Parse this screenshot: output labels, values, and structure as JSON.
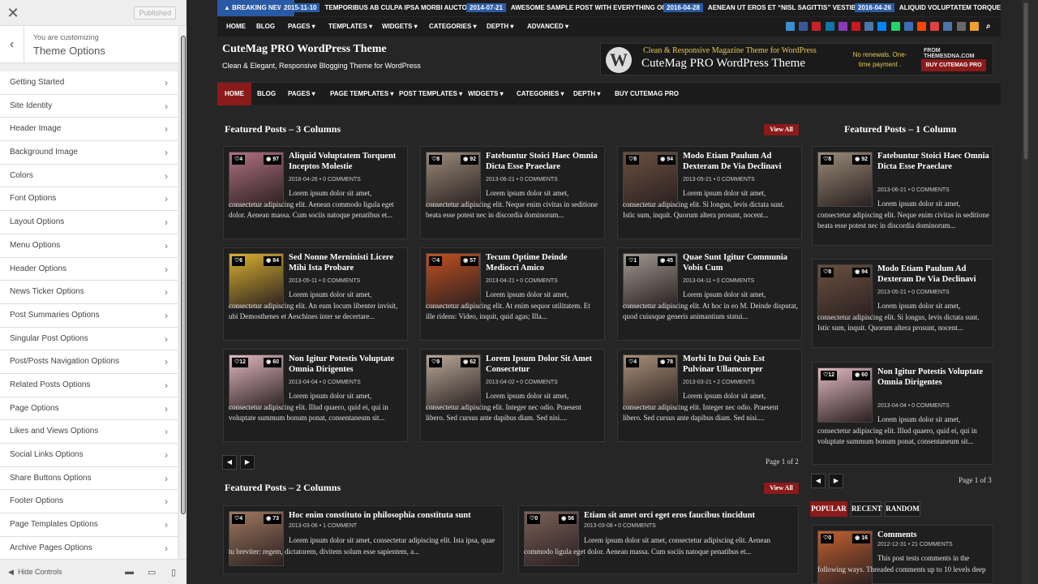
{
  "customizer": {
    "close": "✕",
    "published": "Published",
    "back": "‹",
    "you_are": "You are customizing",
    "title": "Theme Options",
    "items": [
      "Getting Started",
      "Site Identity",
      "Header Image",
      "Background Image",
      "Colors",
      "Font Options",
      "Layout Options",
      "Menu Options",
      "Header Options",
      "News Ticker Options",
      "Post Summaries Options",
      "Singular Post Options",
      "Post/Posts Navigation Options",
      "Related Posts Options",
      "Page Options",
      "Likes and Views Options",
      "Social Links Options",
      "Share Buttons Options",
      "Footer Options",
      "Page Templates Options",
      "Archive Pages Options"
    ],
    "hide_controls": "Hide Controls"
  },
  "ticker": {
    "label": "BREAKING NEWS",
    "items": [
      {
        "date": "2015-11-10",
        "text": "TEMPORIBUS AB CULPA IPSA MORBI AUCTOR"
      },
      {
        "date": "2014-07-21",
        "text": "AWESOME SAMPLE POST WITH EVERYTHING ON IT"
      },
      {
        "date": "2016-04-28",
        "text": "AENEAN UT EROS ET “NISL SAGITTIS” VESTIBULUM"
      },
      {
        "date": "2016-04-26",
        "text": "ALIQUID VOLUPTATEM TORQUENT INCEPTOS MOLESTIE"
      }
    ]
  },
  "topnav": [
    "HOME",
    "BLOG",
    "PAGES",
    "TEMPLATES",
    "WIDGETS",
    "CATEGORIES",
    "DEPTH",
    "ADVANCED"
  ],
  "header": {
    "title": "CuteMag PRO WordPress Theme",
    "tagline": "Clean & Elegant, Responsive Blogging Theme for WordPress"
  },
  "ad": {
    "logo": "W",
    "line1": "Clean & Responsive Magazine Theme for WordPress",
    "line2": "CuteMag PRO WordPress Theme",
    "line3": "No renewals. One-time payment .",
    "line4": "FROM THEMESDNA.COM",
    "button": "BUY CUTEMAG PRO"
  },
  "mainnav": [
    "HOME",
    "BLOG",
    "PAGES",
    "PAGE TEMPLATES",
    "POST TEMPLATES",
    "WIDGETS",
    "CATEGORIES",
    "DEPTH",
    "BUY CUTEMAG PRO"
  ],
  "sections": {
    "three_col": "Featured Posts – 3 Columns",
    "one_col": "Featured Posts – 1 Column",
    "two_col": "Featured Posts – 2 Columns",
    "view_all": "View All"
  },
  "grid": [
    {
      "likes": "4",
      "views": "97",
      "title": "Aliquid Voluptatem Torquent Inceptos Molestie",
      "date": "2016-04-26",
      "comments": "0 COMMENTS",
      "excerpt": "Lorem ipsum dolor sit amet, consectetur adipiscing elit. Aenean commodo ligula eget dolor. Aenean massa. Cum sociis natoque penatibus et...",
      "color": "#b07080"
    },
    {
      "likes": "8",
      "views": "92",
      "title": "Fatebuntur Stoici Haec Omnia Dicta Esse Praeclare",
      "date": "2013-06-21",
      "comments": "0 COMMENTS",
      "excerpt": "Lorem ipsum dolor sit amet, consectetur adipiscing elit. Neque enim civitas in seditione beata esse potest nec in discordia dominorum...",
      "color": "#9a8a78"
    },
    {
      "likes": "8",
      "views": "94",
      "title": "Modo Etiam Paulum Ad Dexteram De Via Declinavi",
      "date": "2013-05-21",
      "comments": "0 COMMENTS",
      "excerpt": "Lorem ipsum dolor sit amet, consectetur adipiscing elit. Si longus, levis dictata sunt. Istic sum, inquit. Quorum altera prosunt, nocent...",
      "color": "#6a5040"
    },
    {
      "likes": "6",
      "views": "84",
      "title": "Sed Nonne Merninisti Licere Mihi Ista Probare",
      "date": "2013-05-11",
      "comments": "0 COMMENTS",
      "excerpt": "Lorem ipsum dolor sit amet, consectetur adipiscing elit. An eum locum libenter invisit, ubi Demosthenes et Aeschines inter se decertare...",
      "color": "#d8b030"
    },
    {
      "likes": "4",
      "views": "57",
      "title": "Tecum Optime Deinde Mediocri Amico",
      "date": "2013-04-21",
      "comments": "0 COMMENTS",
      "excerpt": "Lorem ipsum dolor sit amet, consectetur adipiscing elit. At enim sequor utilitatem. Et ille ridens: Video, inquit, quid agas; Illa...",
      "color": "#c05020"
    },
    {
      "likes": "1",
      "views": "45",
      "title": "Quae Sunt Igitur Communia Vobis Cum",
      "date": "2013-04-11",
      "comments": "0 COMMENTS",
      "excerpt": "Lorem ipsum dolor sit amet, consectetur adipiscing elit. At hoc in eo M. Deinde disputat, quod cuiusque generis animantium statui...",
      "color": "#a09890"
    },
    {
      "likes": "12",
      "views": "60",
      "title": "Non Igitur Potestis Voluptate Omnia Dirigentes",
      "date": "2013-04-04",
      "comments": "0 COMMENTS",
      "excerpt": "Lorem ipsum dolor sit amet, consectetur adipiscing elit. Illud quaero, quid ei, qui in voluptate summum bonum ponat, consentaneum sit...",
      "color": "#e0b8c0"
    },
    {
      "likes": "9",
      "views": "62",
      "title": "Lorem Ipsum Dolor Sit Amet Consectetur",
      "date": "2013-04-02",
      "comments": "0 COMMENTS",
      "excerpt": "Lorem ipsum dolor sit amet, consectetur adipiscing elit. Integer nec odio. Praesent libero. Sed cursus ante dapibus diam. Sed nisi....",
      "color": "#b8a898"
    },
    {
      "likes": "4",
      "views": "78",
      "title": "Morbi In Dui Quis Est Pulvinar Ullamcorper",
      "date": "2013-03-21",
      "comments": "2 COMMENTS",
      "excerpt": "Lorem ipsum dolor sit amet, consectetur adipiscing elit. Integer nec odio. Praesent libero. Sed cursus ante dapibus diam. Sed nisi....",
      "color": "#a89078"
    }
  ],
  "grid_page": "Page 1 of 2",
  "side": [
    {
      "likes": "8",
      "views": "92",
      "title": "Fatebuntur Stoici Haec Omnia Dicta Esse Praeclare",
      "date": "2013-06-21",
      "comments": "0 COMMENTS",
      "excerpt": "Lorem ipsum dolor sit amet, consectetur adipiscing elit. Neque enim civitas in seditione beata esse potest nec in discordia dominorum...",
      "color": "#9a8a78"
    },
    {
      "likes": "8",
      "views": "94",
      "title": "Modo Etiam Paulum Ad Dexteram De Via Declinavi",
      "date": "2013-05-21",
      "comments": "0 COMMENTS",
      "excerpt": "Lorem ipsum dolor sit amet, consectetur adipiscing elit. Si longus, levis dictata sunt. Istic sum, inquit. Quorum altera prosunt, nocent...",
      "color": "#6a5040"
    },
    {
      "likes": "12",
      "views": "60",
      "title": "Non Igitur Potestis Voluptate Omnia Dirigentes",
      "date": "2013-04-04",
      "comments": "0 COMMENTS",
      "excerpt": "Lorem ipsum dolor sit amet, consectetur adipiscing elit. Illud quaero, quid ei, qui in voluptate summum bonum ponat, consentaneum sit...",
      "color": "#e0b8c0"
    }
  ],
  "side_page": "Page 1 of 3",
  "two": [
    {
      "likes": "4",
      "views": "73",
      "title": "Hoc enim constituto in philosophia constituta sunt",
      "date": "2013-03-06",
      "comments": "1 COMMENT",
      "excerpt": "Lorem ipsum dolor sit amet, consectetur adipiscing elit. Ista ipsa, quae tu breviter: regem, dictatorem, divitem solum esse sapientem, a...",
      "color": "#a07860"
    },
    {
      "likes": "0",
      "views": "56",
      "title": "Etiam sit amet orci eget eros faucibus tincidunt",
      "date": "2013-03-08",
      "comments": "0 COMMENTS",
      "excerpt": "Lorem ipsum dolor sit amet, consectetur adipiscing elit. Aenean commodo ligula eget dolor. Aenean massa. Cum sociis natoque penatibus et...",
      "color": "#7a6058"
    }
  ],
  "tabs": [
    "POPULAR",
    "RECENT",
    "RANDOM"
  ],
  "comments_widget": {
    "likes": "0",
    "views": "16",
    "title": "Comments",
    "date": "2012-12-31",
    "comments": "21 COMMENTS",
    "excerpt": "This post tests comments in the following ways. Threaded comments up to 10 levels deep",
    "color": "#c06030"
  },
  "accent": "#8b1a1a"
}
